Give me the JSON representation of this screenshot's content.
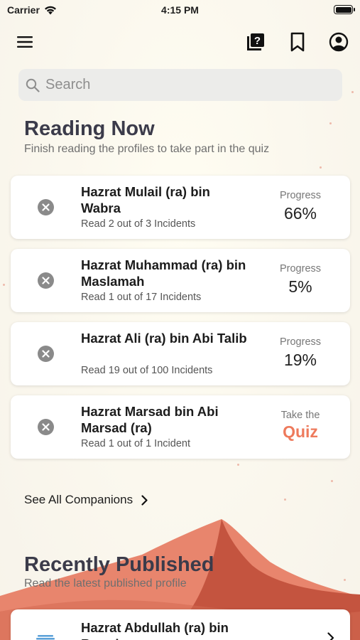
{
  "status_bar": {
    "carrier": "Carrier",
    "time": "4:15 PM"
  },
  "nav": {
    "menu_icon": "hamburger-icon",
    "quiz_icon": "question-book-icon",
    "bookmark_icon": "bookmark-icon",
    "profile_icon": "account-circle-icon"
  },
  "search": {
    "placeholder": "Search",
    "value": ""
  },
  "reading_now": {
    "title": "Reading Now",
    "subtitle": "Finish reading the profiles to take part in the quiz",
    "items": [
      {
        "name": "Hazrat Mulail (ra) bin Wabra",
        "count": "Read 2 out of 3 Incidents",
        "label": "Progress",
        "value": "66%"
      },
      {
        "name": "Hazrat Muhammad (ra) bin Maslamah",
        "count": "Read 1 out of 17 Incidents",
        "label": "Progress",
        "value": "5%"
      },
      {
        "name": "Hazrat Ali (ra) bin Abi Talib",
        "count": "Read 19 out of 100 Incidents",
        "label": "Progress",
        "value": "19%"
      },
      {
        "name": "Hazrat Marsad bin Abi Marsad (ra)",
        "count": "Read 1 out of 1 Incident",
        "label": "Take the",
        "value": "Quiz"
      }
    ]
  },
  "see_all": {
    "label": "See All Companions"
  },
  "recently_published": {
    "title": "Recently Published",
    "subtitle": "Read the latest published profile",
    "items": [
      {
        "name": "Hazrat Abdullah (ra) bin Rawaha"
      }
    ]
  },
  "colors": {
    "accent": "#ee7a5c",
    "dune_light": "#e8856d",
    "dune_dark": "#c4543f",
    "heading": "#3b3b4a"
  }
}
